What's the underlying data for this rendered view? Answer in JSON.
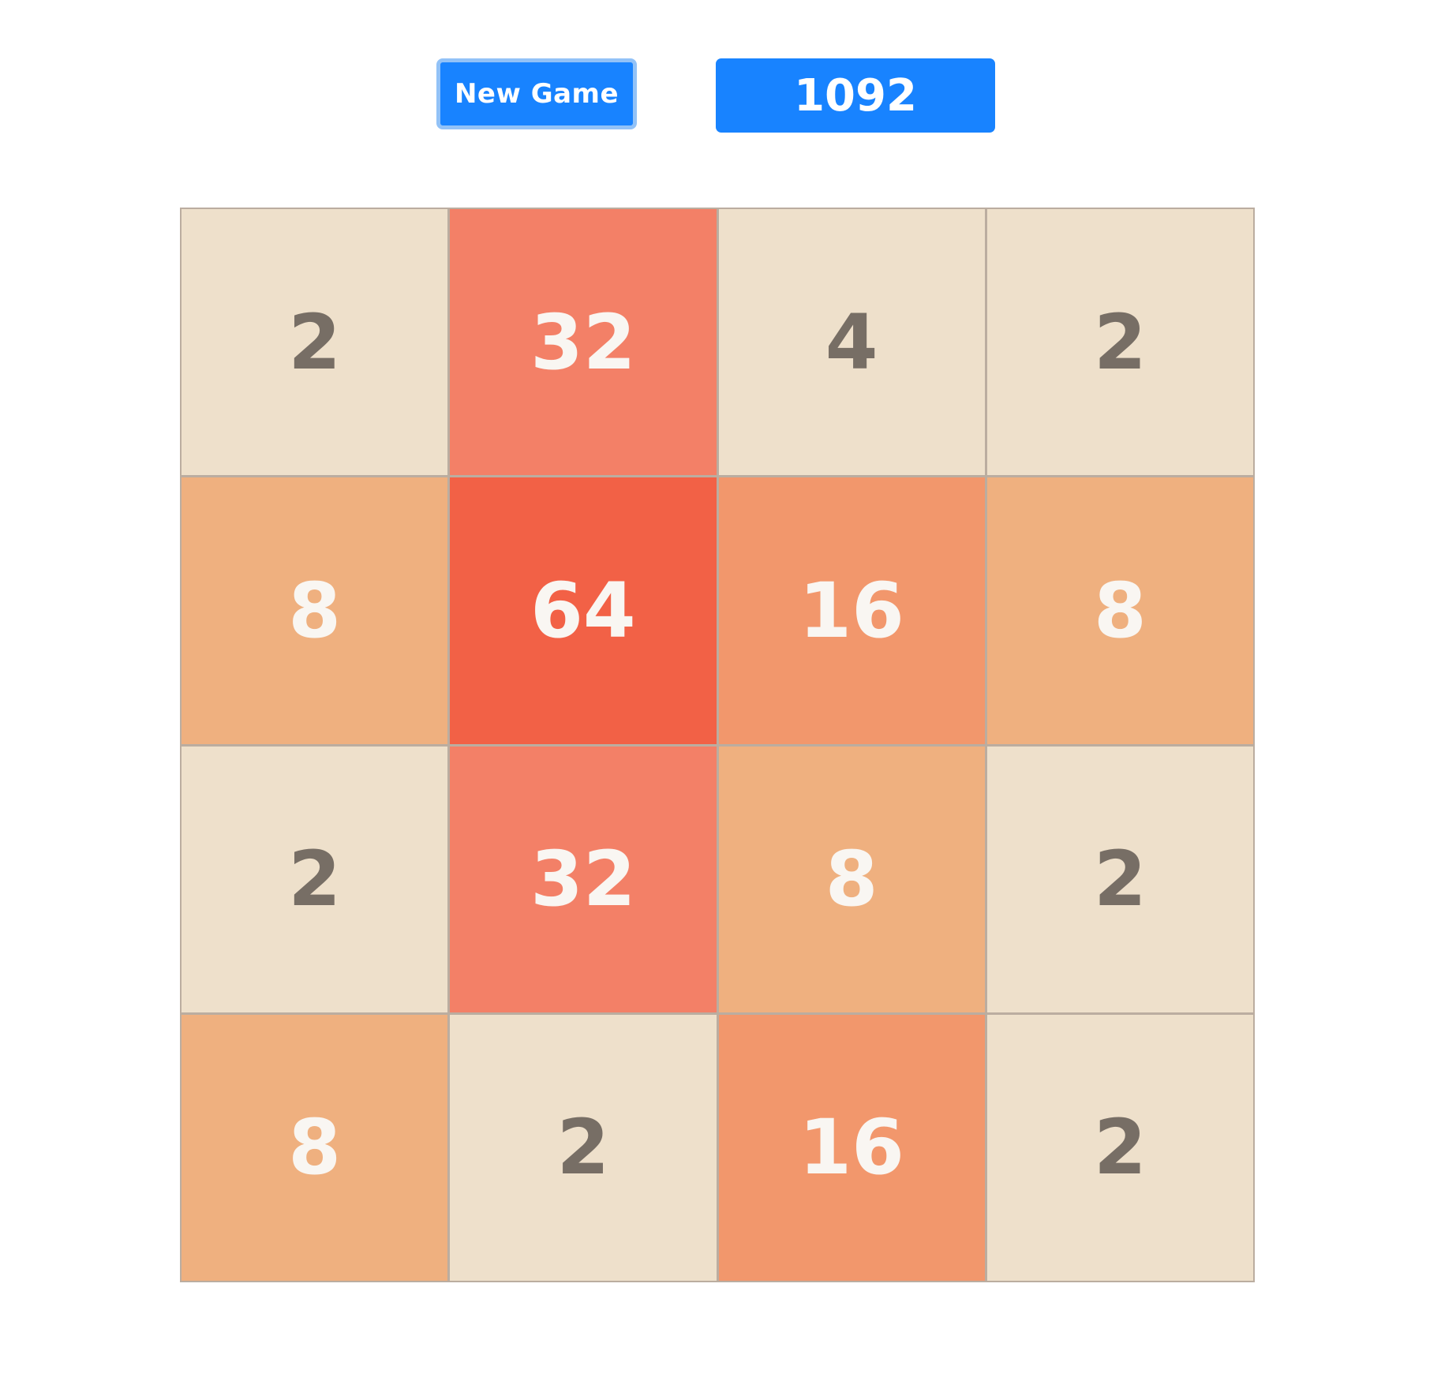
{
  "toolbar": {
    "new_game_label": "New Game",
    "score": "1092"
  },
  "board": {
    "rows": [
      [
        "2",
        "32",
        "4",
        "2"
      ],
      [
        "8",
        "64",
        "16",
        "8"
      ],
      [
        "2",
        "32",
        "8",
        "2"
      ],
      [
        "8",
        "2",
        "16",
        "2"
      ]
    ]
  },
  "colors": {
    "accent": "#1883ff",
    "board_border": "#bbada0",
    "tile_2": "#eee0cb",
    "tile_4": "#eee0cb",
    "tile_8": "#efb07f",
    "tile_16": "#f2976c",
    "tile_32": "#f38067",
    "tile_64": "#f26146",
    "dark_text": "#776e65",
    "light_text": "#f9f6f2"
  }
}
